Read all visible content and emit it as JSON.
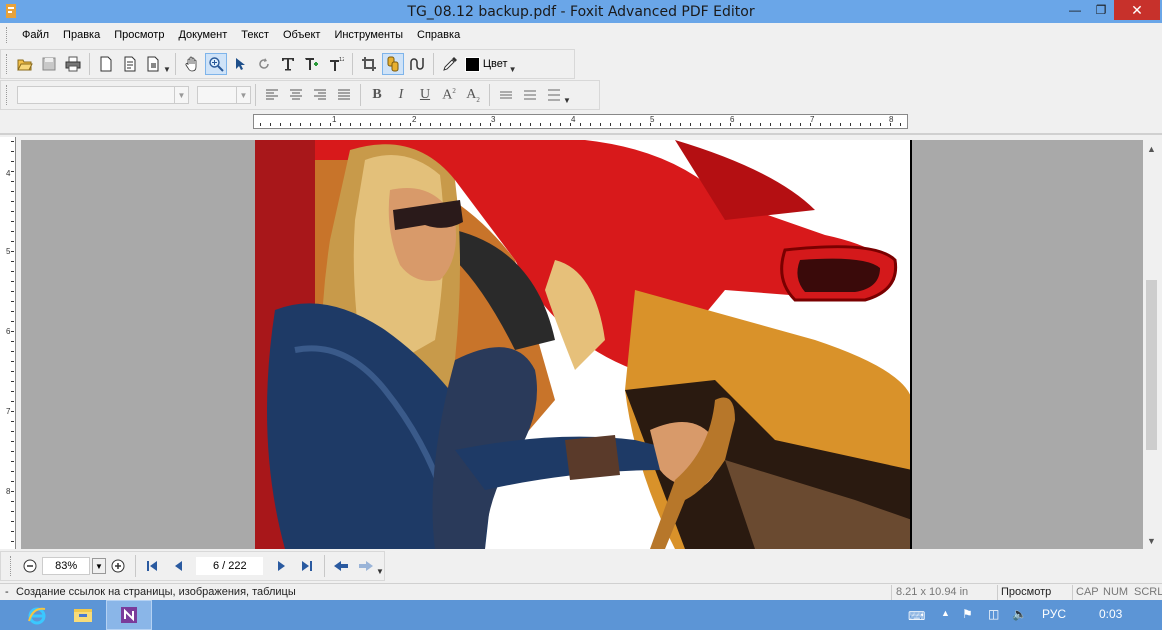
{
  "window": {
    "title": "TG_08.12 backup.pdf - Foxit Advanced PDF Editor"
  },
  "menu": [
    "Файл",
    "Правка",
    "Просмотр",
    "Документ",
    "Текст",
    "Объект",
    "Инструменты",
    "Справка"
  ],
  "toolbar": {
    "color_label": "Цвет"
  },
  "ruler": {
    "h_numbers": [
      "1",
      "2",
      "3",
      "4",
      "5",
      "6",
      "7",
      "8"
    ],
    "v_numbers": [
      "4",
      "5",
      "6",
      "7",
      "8"
    ]
  },
  "nav": {
    "zoom": "83%",
    "page": "6 / 222"
  },
  "status": {
    "hint": "Создание ссылок на страницы, изображения, таблицы",
    "page_size": "8.21 x 10.94 in",
    "mode": "Просмотр",
    "cap": "CAP",
    "num": "NUM",
    "scrl": "SCRL"
  },
  "taskbar": {
    "lang": "РУС",
    "time": "0:03"
  },
  "colors": {
    "titlebar": "#6aa6e8",
    "close": "#c7312b",
    "taskbar": "#5c95d6",
    "workspace": "#a9a9a9"
  },
  "icons": [
    "app-icon",
    "open-icon",
    "save-icon",
    "print-icon",
    "new-page-icon",
    "page-icon",
    "page-insert-icon",
    "hand-icon",
    "zoom-icon",
    "select-arrow-icon",
    "rotate-icon",
    "text-icon",
    "add-text-icon",
    "text-format-icon",
    "crop-icon",
    "link-icon",
    "path-icon",
    "eyedropper-icon",
    "color-icon",
    "align-left-icon",
    "align-center-icon",
    "align-right-icon",
    "justify-icon",
    "bold-icon",
    "italic-icon",
    "underline-icon",
    "superscript-icon",
    "subscript-icon",
    "list-icon",
    "ie-icon",
    "explorer-icon",
    "onenote-icon",
    "keyboard-icon",
    "flag-icon",
    "network-icon",
    "volume-icon"
  ]
}
